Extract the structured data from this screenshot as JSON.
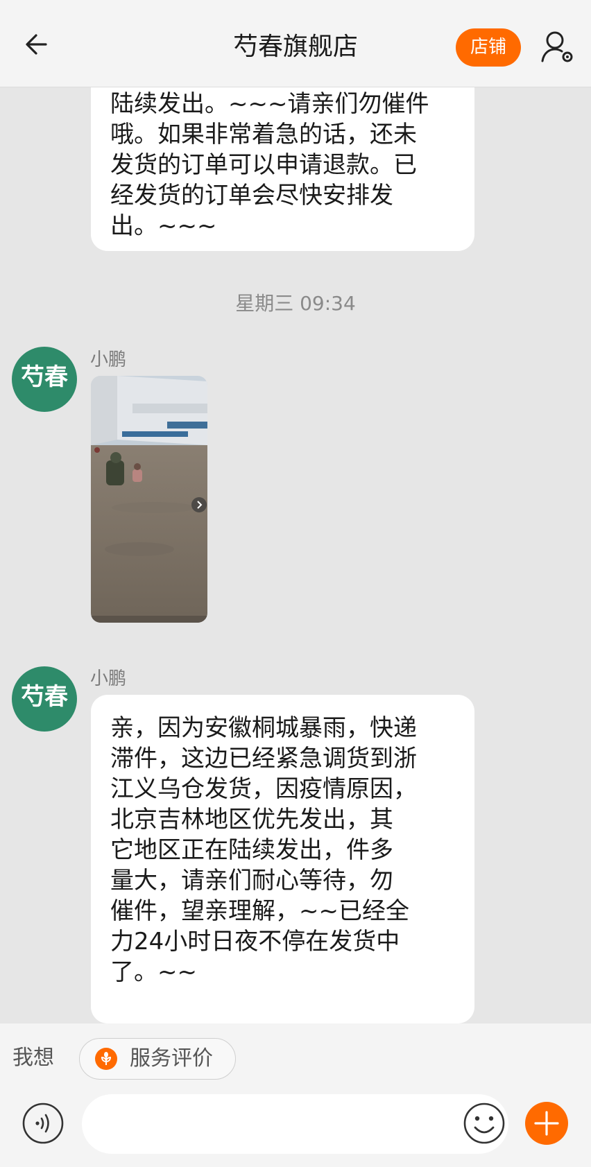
{
  "header": {
    "title": "芍春旗舰店",
    "shop_label": "店铺"
  },
  "messages": {
    "bubble_1_text": "陆续发出。~~~请亲们勿催件\n哦。如果非常着急的话，还未\n发货的订单可以申请退款。已\n经发货的订单会尽快安排发\n出。~~~",
    "timestamp": "星期三 09:34",
    "avatar_text": "芍春",
    "sender_name": "小鹏",
    "bubble_2_text": "亲，因为安徽桐城暴雨，快递\n滞件，这边已经紧急调货到浙\n江义乌仓发货，因疫情原因，\n北京吉林地区优先发出，其\n它地区正在陆续发出，件多\n量大，请亲们耐心等待，勿\n催件，望亲理解，~~已经全\n力24小时日夜不停在发货中\n了。~~"
  },
  "bottom_bar": {
    "want_label": "我想",
    "service_chip_label": "服务评价",
    "input_value": "",
    "input_placeholder": ""
  },
  "colors": {
    "accent": "#ff6a00",
    "avatar_green": "#2e8b6a",
    "background": "#e6e6e6"
  },
  "icons": {
    "back": "back-arrow-icon",
    "profile": "user-settings-icon",
    "voice": "voice-icon",
    "emoji": "emoji-icon",
    "plus": "plus-icon",
    "chip": "wheat-icon"
  }
}
